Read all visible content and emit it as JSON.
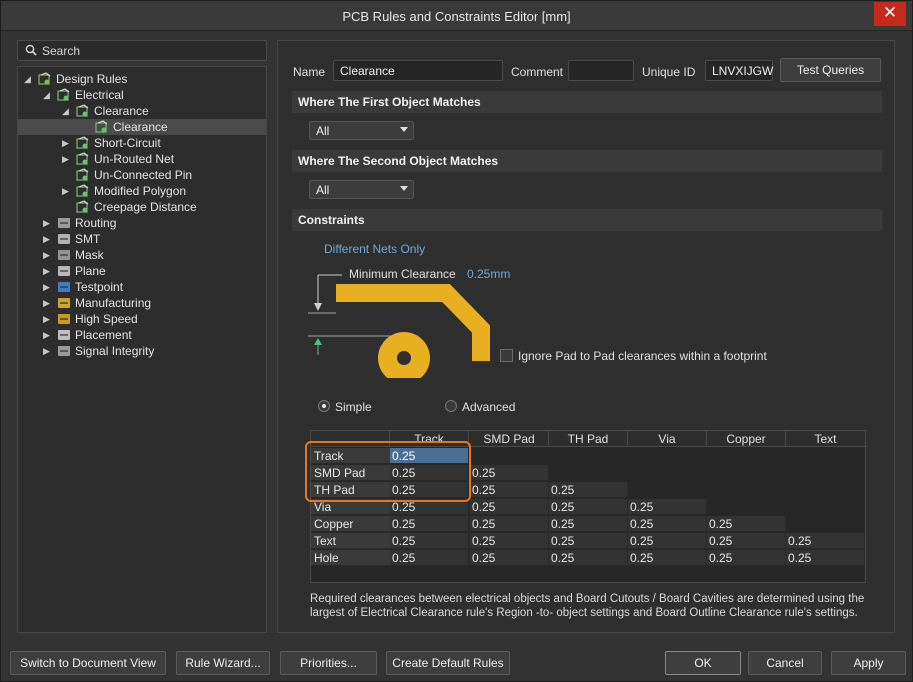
{
  "window": {
    "title": "PCB Rules and Constraints Editor [mm]",
    "close_glyph": "✕"
  },
  "search": {
    "placeholder": "Search"
  },
  "tree": [
    {
      "label": "Design Rules",
      "expand": "◢",
      "icon": "design-rules"
    },
    {
      "label": "Electrical",
      "expand": "◢",
      "icon": "rule"
    },
    {
      "label": "Clearance",
      "expand": "◢",
      "icon": "rule"
    },
    {
      "label": "Clearance",
      "expand": "",
      "icon": "rule",
      "selected": true
    },
    {
      "label": "Short-Circuit",
      "expand": "▶",
      "icon": "rule"
    },
    {
      "label": "Un-Routed Net",
      "expand": "▶",
      "icon": "rule"
    },
    {
      "label": "Un-Connected Pin",
      "expand": "",
      "icon": "rule"
    },
    {
      "label": "Modified Polygon",
      "expand": "▶",
      "icon": "rule"
    },
    {
      "label": "Creepage Distance",
      "expand": "",
      "icon": "rule"
    },
    {
      "label": "Routing",
      "expand": "▶",
      "icon": "routing"
    },
    {
      "label": "SMT",
      "expand": "▶",
      "icon": "smt"
    },
    {
      "label": "Mask",
      "expand": "▶",
      "icon": "mask"
    },
    {
      "label": "Plane",
      "expand": "▶",
      "icon": "plane"
    },
    {
      "label": "Testpoint",
      "expand": "▶",
      "icon": "testpoint"
    },
    {
      "label": "Manufacturing",
      "expand": "▶",
      "icon": "manufacturing"
    },
    {
      "label": "High Speed",
      "expand": "▶",
      "icon": "highspeed"
    },
    {
      "label": "Placement",
      "expand": "▶",
      "icon": "placement"
    },
    {
      "label": "Signal Integrity",
      "expand": "▶",
      "icon": "signal"
    }
  ],
  "rule": {
    "name_label": "Name",
    "name": "Clearance",
    "comment_label": "Comment",
    "comment": "",
    "uid_label": "Unique ID",
    "uid": "LNVXIJGW",
    "test_queries": "Test Queries"
  },
  "first_match": {
    "title": "Where The First Object Matches",
    "value": "All"
  },
  "second_match": {
    "title": "Where The Second Object Matches",
    "value": "All"
  },
  "constraints": {
    "title": "Constraints",
    "nets": "Different Nets Only",
    "min_clearance_label": "Minimum Clearance",
    "min_clearance_value": "0.25mm",
    "ignore_pad": "Ignore Pad to Pad clearances within a footprint",
    "simple": "Simple",
    "advanced": "Advanced"
  },
  "grid": {
    "columns": [
      "Track",
      "SMD Pad",
      "TH Pad",
      "Via",
      "Copper",
      "Text"
    ],
    "rows": [
      {
        "label": "Track",
        "values": [
          "0.25"
        ]
      },
      {
        "label": "SMD Pad",
        "values": [
          "0.25",
          "0.25"
        ]
      },
      {
        "label": "TH Pad",
        "values": [
          "0.25",
          "0.25",
          "0.25"
        ]
      },
      {
        "label": "Via",
        "values": [
          "0.25",
          "0.25",
          "0.25",
          "0.25"
        ]
      },
      {
        "label": "Copper",
        "values": [
          "0.25",
          "0.25",
          "0.25",
          "0.25",
          "0.25"
        ]
      },
      {
        "label": "Text",
        "values": [
          "0.25",
          "0.25",
          "0.25",
          "0.25",
          "0.25",
          "0.25"
        ]
      },
      {
        "label": "Hole",
        "values": [
          "0.25",
          "0.25",
          "0.25",
          "0.25",
          "0.25",
          "0.25"
        ]
      }
    ]
  },
  "note": "Required clearances between electrical objects and Board Cutouts / Board Cavities are determined using the largest of Electrical Clearance rule's Region -to- object settings and Board Outline Clearance rule's settings.",
  "buttons": {
    "switch": "Switch to Document View",
    "wizard": "Rule Wizard...",
    "priorities": "Priorities...",
    "create_default": "Create Default Rules",
    "ok": "OK",
    "cancel": "Cancel",
    "apply": "Apply"
  },
  "colors": {
    "accent_orange": "#e9741f",
    "track_gold": "#e8b020",
    "selection_blue": "#4a6e96",
    "close_red": "#c42b1c"
  }
}
